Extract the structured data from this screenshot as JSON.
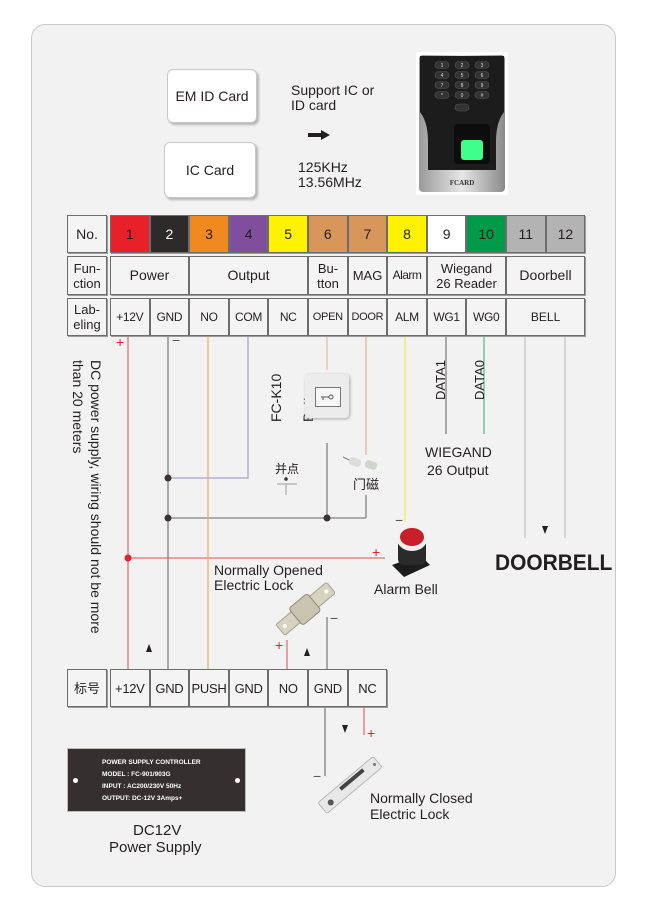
{
  "cards": {
    "em_id": "EM ID Card",
    "ic": "IC Card",
    "support_line1": "Support IC or",
    "support_line2": "ID card",
    "freq1": "125KHz",
    "freq2": "13.56MHz",
    "arrow_icon": "right-arrow-icon"
  },
  "reader": {
    "brand": "FCARD",
    "keys": [
      "1",
      "2",
      "3",
      "4",
      "5",
      "6",
      "7",
      "8",
      "9",
      "*",
      "0",
      "#"
    ]
  },
  "table": {
    "row_headers": {
      "no": "No.",
      "function_1": "Fun-",
      "function_2": "ction",
      "labeling_1": "Lab-",
      "labeling_2": "eling"
    },
    "terminals": [
      {
        "no": "1",
        "color": "#e8202a",
        "text_color": "#231f20",
        "label": "+12V"
      },
      {
        "no": "2",
        "color": "#2e2a29",
        "text_color": "#ffffff",
        "label": "GND"
      },
      {
        "no": "3",
        "color": "#f08a1f",
        "text_color": "#231f20",
        "label": "NO"
      },
      {
        "no": "4",
        "color": "#7f4f9e",
        "text_color": "#231f20",
        "label": "COM"
      },
      {
        "no": "5",
        "color": "#fff200",
        "text_color": "#231f20",
        "label": "NC"
      },
      {
        "no": "6",
        "color": "#d9965b",
        "text_color": "#231f20",
        "label": "OPEN"
      },
      {
        "no": "7",
        "color": "#d9965b",
        "text_color": "#231f20",
        "label": "DOOR"
      },
      {
        "no": "8",
        "color": "#fff200",
        "text_color": "#231f20",
        "label": "ALM"
      },
      {
        "no": "9",
        "color": "#ffffff",
        "text_color": "#231f20",
        "label": "WG1"
      },
      {
        "no": "10",
        "color": "#009a49",
        "text_color": "#231f20",
        "label": "WG0"
      },
      {
        "no": "11",
        "color": "#b3b3b3",
        "text_color": "#231f20",
        "label": "BELL"
      },
      {
        "no": "12",
        "color": "#b3b3b3",
        "text_color": "#231f20",
        "label": ""
      }
    ],
    "functions": {
      "power": "Power",
      "output": "Output",
      "button_1": "Bu-",
      "button_2": "tton",
      "mag": "MAG",
      "alarm": "Alarm",
      "wiegand_1": "Wiegand",
      "wiegand_2": "26 Reader",
      "doorbell": "Doorbell"
    }
  },
  "notes": {
    "dc_warning_1": "DC power supply, wiring should not be more",
    "dc_warning_2": "than 20 meters",
    "button_model": "FC-K10",
    "button_label": "Button",
    "parallel_point": "并点",
    "door_sensor": "门磁",
    "data1": "DATA1",
    "data0": "DATA0",
    "wiegand_out_1": "WIEGAND",
    "wiegand_out_2": "26 Output",
    "doorbell": "DOORBELL",
    "no_lock_1": "Normally Opened",
    "no_lock_2": "Electric Lock",
    "alarm_bell": "Alarm Bell",
    "nc_lock_1": "Normally Closed",
    "nc_lock_2": "Electric Lock",
    "psu_1": "DC12V",
    "psu_2": "Power Supply",
    "plus": "+",
    "minus": "−"
  },
  "psu_terminals": {
    "header": "标号",
    "labels": [
      "+12V",
      "GND",
      "PUSH",
      "GND",
      "NO",
      "GND",
      "NC"
    ]
  },
  "psu_plate": {
    "line1": "POWER SUPPLY CONTROLLER",
    "line2": "MODEL  : FC-901/903G",
    "line3": "INPUT    : AC200/230V    50Hz",
    "line4": "OUTPUT: DC-12V  3Amps+"
  }
}
